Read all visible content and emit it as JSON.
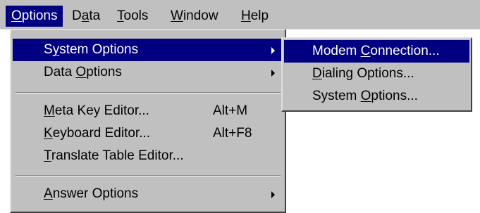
{
  "colors": {
    "menu_face": "#c0c0c0",
    "highlight": "#000080",
    "highlight_text": "#ffffff"
  },
  "menubar": {
    "items": [
      {
        "pre": "",
        "u": "O",
        "post": "ptions"
      },
      {
        "pre": "D",
        "u": "a",
        "post": "ta"
      },
      {
        "pre": "",
        "u": "T",
        "post": "ools"
      },
      {
        "pre": "",
        "u": "W",
        "post": "indow"
      },
      {
        "pre": "",
        "u": "H",
        "post": "elp"
      }
    ]
  },
  "options_menu": {
    "system_options": {
      "pre": "S",
      "u": "y",
      "post": "stem Options"
    },
    "data_options": {
      "pre": "Data ",
      "u": "O",
      "post": "ptions"
    },
    "meta_key_editor": {
      "pre": "",
      "u": "M",
      "post": "eta Key Editor...",
      "accel": "Alt+M"
    },
    "keyboard_editor": {
      "pre": "",
      "u": "K",
      "post": "eyboard Editor...",
      "accel": "Alt+F8"
    },
    "translate_table_editor": {
      "pre": "",
      "u": "T",
      "post": "ranslate Table Editor..."
    },
    "answer_options": {
      "pre": "",
      "u": "A",
      "post": "nswer Options"
    }
  },
  "submenu": {
    "modem_connection": {
      "pre": "Modem ",
      "u": "C",
      "post": "onnection..."
    },
    "dialing_options": {
      "pre": "",
      "u": "D",
      "post": "ialing Options..."
    },
    "system_options": {
      "pre": "System ",
      "u": "O",
      "post": "ptions..."
    }
  }
}
